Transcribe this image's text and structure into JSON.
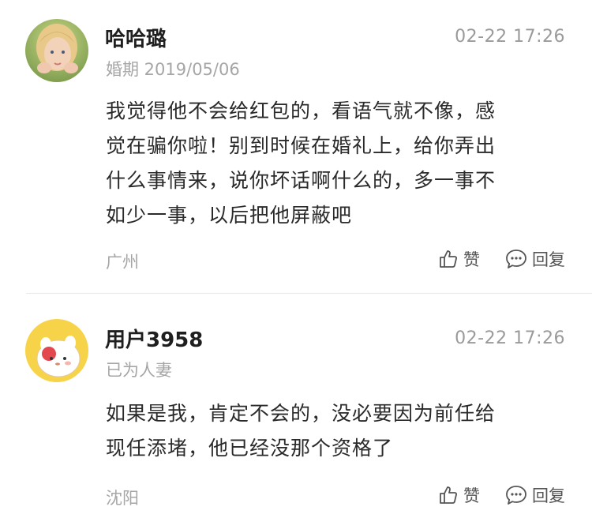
{
  "comments": [
    {
      "username": "哈哈璐",
      "time": "02-22 17:26",
      "meta": "婚期 2019/05/06",
      "body_lines": [
        "我觉得他不会给红包的，看语气就不像，感",
        "觉在骗你啦！别到时候在婚礼上，给你弄出",
        "什么事情来，说你坏话啊什么的，多一事不",
        "如少一事，以后把他屏蔽吧"
      ],
      "location": "广州",
      "like_label": "赞",
      "reply_label": "回复"
    },
    {
      "username": "用户3958",
      "time": "02-22 17:26",
      "meta": "已为人妻",
      "body_lines": [
        "如果是我，肯定不会的，没必要因为前任给",
        "现任添堵，他已经没那个资格了"
      ],
      "location": "沈阳",
      "like_label": "赞",
      "reply_label": "回复"
    }
  ],
  "icons": {
    "like": "thumbs-up-icon",
    "reply": "speech-bubble-icon"
  },
  "colors": {
    "text": "#2a2a2a",
    "secondary": "#a6a6a6",
    "divider": "#e9e9e9"
  }
}
